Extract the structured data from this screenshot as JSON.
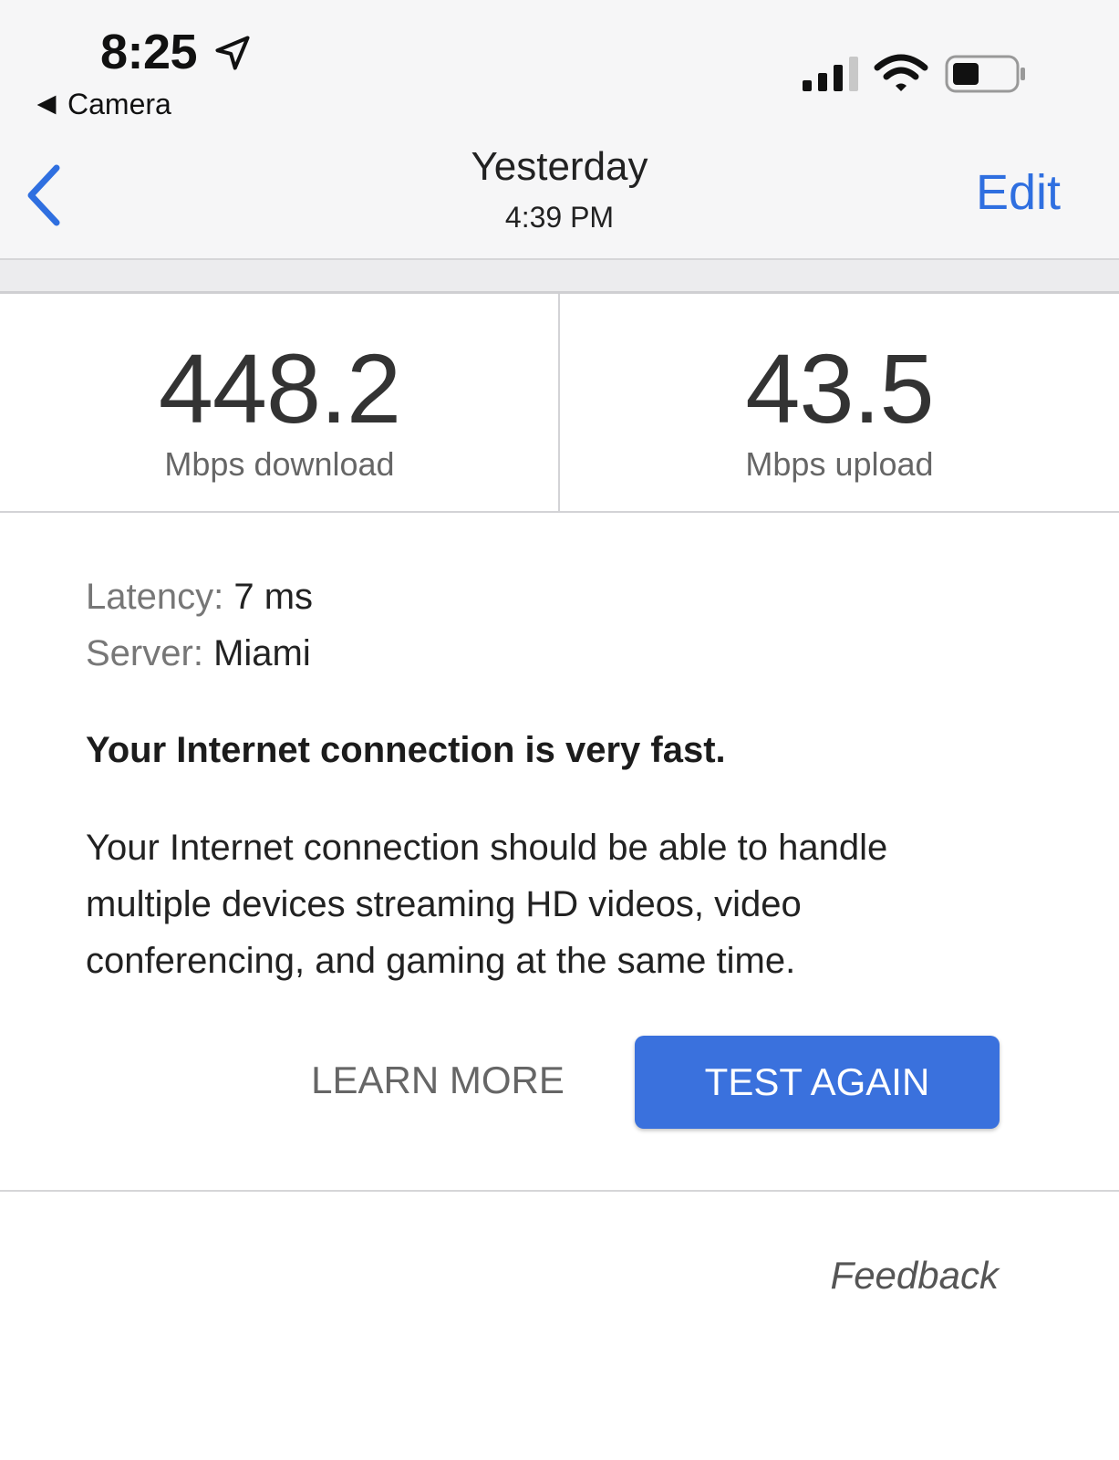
{
  "status_bar": {
    "time": "8:25",
    "back_app": "Camera",
    "icons": [
      "location-arrow-icon",
      "cellular-signal-icon",
      "wifi-icon",
      "battery-icon"
    ]
  },
  "nav": {
    "title": "Yesterday",
    "subtitle": "4:39 PM",
    "edit_label": "Edit",
    "back_icon": "chevron-left-icon"
  },
  "results": {
    "download": {
      "value": "448.2",
      "label": "Mbps download"
    },
    "upload": {
      "value": "43.5",
      "label": "Mbps upload"
    }
  },
  "details": {
    "latency_label": "Latency:",
    "latency_value": "7 ms",
    "server_label": "Server:",
    "server_value": "Miami"
  },
  "summary": {
    "headline": "Your Internet connection is very fast.",
    "description": "Your Internet connection should be able to handle multiple devices streaming HD videos, video conferencing, and gaming at the same time."
  },
  "actions": {
    "learn_more": "LEARN MORE",
    "test_again": "TEST AGAIN"
  },
  "footer": {
    "feedback": "Feedback"
  },
  "colors": {
    "accent": "#3a71dd",
    "link": "#2f6fe0",
    "background": "#ffffff"
  }
}
